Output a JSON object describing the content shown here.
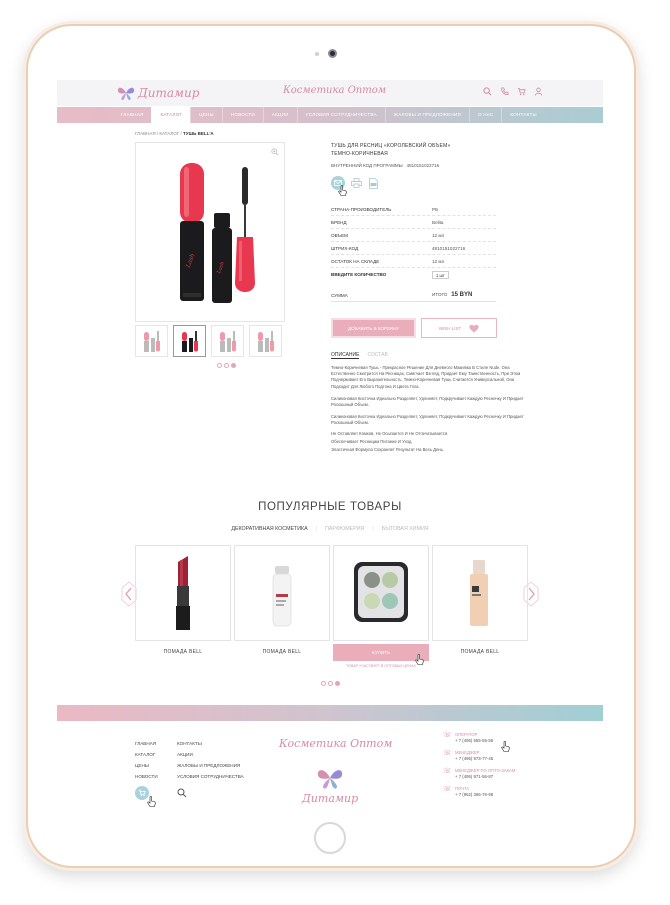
{
  "header": {
    "logo_text": "Дитамир",
    "tagline": "Косметика Оптом"
  },
  "nav": {
    "items": [
      {
        "label": "ГЛАВНАЯ",
        "active": false
      },
      {
        "label": "КАТАЛОГ",
        "active": true
      },
      {
        "label": "ЦЕНЫ",
        "active": false
      },
      {
        "label": "НОВОСТИ",
        "active": false
      },
      {
        "label": "АКЦИИ",
        "active": false
      },
      {
        "label": "УСЛОВИЯ СОТРУДНИЧЕСТВА",
        "active": false
      },
      {
        "label": "ЖАЛОБЫ И ПРЕДЛОЖЕНИЯ",
        "active": false
      },
      {
        "label": "О НАС",
        "active": false
      },
      {
        "label": "КОНТАКТЫ",
        "active": false
      }
    ]
  },
  "breadcrumb": {
    "path": "ГЛАВНАЯ / КАТАЛОГ / ",
    "current": "ТУШЬ BELL'A"
  },
  "product": {
    "title_line1": "ТУШЬ ДЛЯ РЕСНИЦ «КОРОЛЕВСКИЙ ОБЪЕМ»",
    "title_line2": "ТЕМНО-КОРИЧНЕВАЯ",
    "code_label": "ВНУТРЕННИЙ КОД ПРОГРАММЫ",
    "code_value": "4810151022716",
    "specs": [
      {
        "key": "СТРАНА-ПРОИЗВОДИТЕЛЬ",
        "value": "РБ"
      },
      {
        "key": "БРЕНД",
        "value": "Belita"
      },
      {
        "key": "ОБЪЕМ",
        "value": "12 мл"
      },
      {
        "key": "ШТРИХ-КОД",
        "value": "4810151022716"
      },
      {
        "key": "ОСТАТОК НА СКЛАДЕ",
        "value": "12 мл"
      }
    ],
    "qty_label": "ВВЕДИТЕ КОЛИЧЕСТВО",
    "qty_value": "1 шт",
    "sum_label": "СУММА",
    "total_label": "ИТОГО",
    "total_value": "15 BYN",
    "add_to_cart": "ДОБАВИТЬ В КОРЗИНУ",
    "wishlist": "WISH LIST",
    "desc_tab_active": "ОПИСАНИЕ",
    "desc_tab_inactive": "СОСТАВ",
    "description": [
      "Темно-Коричневая Тушь - Прекрасное Решение Для Дневного Макияжа В Стиле Nude. Она Естественно Смотрится На Ресницах, Смягчает Взгляд, Придает Ему Таинственность, При Этом Подчеркивает Его Выразительность. Темно-Коричневая Тушь Считается Универсальной, Она Подходит Для Любого Подтона И Цвета Глаз.",
      "Силиконовая Кисточка Идеально Разделяет, Удлиняет, Подкручивает Каждую Ресничку И Придает Роскошный Объем.",
      "Силиконовая Кисточка Идеально Разделяет, Удлиняет, Подкручивает Каждую Ресничку И Придает Роскошный Объем.",
      "Не Оставляет Комков, Не Осыпается И Не Отпечатывается.",
      "Обеспечивает Ресницам Питание И Уход.",
      "Эластичная Формула Сохраняет Результат На Весь День."
    ]
  },
  "popular": {
    "title": "ПОПУЛЯРНЫЕ ТОВАРЫ",
    "tabs": [
      "ДЕКОРАТИВНАЯ КОСМЕТИКА",
      "ПАРФЮМЕРИЯ",
      "БЫТОВАЯ ХИМИЯ"
    ],
    "items": [
      {
        "name": "ПОМАДА BELL"
      },
      {
        "name": "ПОМАДА BELL"
      },
      {
        "name": "",
        "button": "КУПИТЬ",
        "link": "ТОВАР УЧАСТВУЕТ В ОПТОВЫХ ЦЕНАХ"
      },
      {
        "name": "ПОМАДА BELL"
      }
    ]
  },
  "footer": {
    "col1": [
      "ГЛАВНАЯ",
      "КАТАЛОГ",
      "ЦЕНЫ",
      "НОВОСТИ"
    ],
    "col2": [
      "КОНТАКТЫ",
      "АКЦИИ",
      "ЖАЛОБЫ И ПРЕДЛОЖЕНИЯ",
      "УСЛОВИЯ СОТРУДНИЧЕСТВА"
    ],
    "tagline": "Косметика Оптом",
    "logo_text": "Дитамир",
    "contacts": [
      {
        "label": "ОПЕРАТОР",
        "number": "+ 7 (495) 555-55-55"
      },
      {
        "label": "МЕНЕДЖЕР",
        "number": "+ 7 (495) 973-77-46"
      },
      {
        "label": "МЕНЕДЖЕР ПО ОПТО-ЗАКАМ",
        "number": "+ 7 (495) 971-56-87"
      },
      {
        "label": "ПОЧТА",
        "number": "+ 7 (962) 366-76-98"
      }
    ]
  },
  "colors": {
    "accent_pink": "#eaaebb",
    "accent_teal": "#a9d3dc",
    "brand_text": "#d98aa6"
  }
}
